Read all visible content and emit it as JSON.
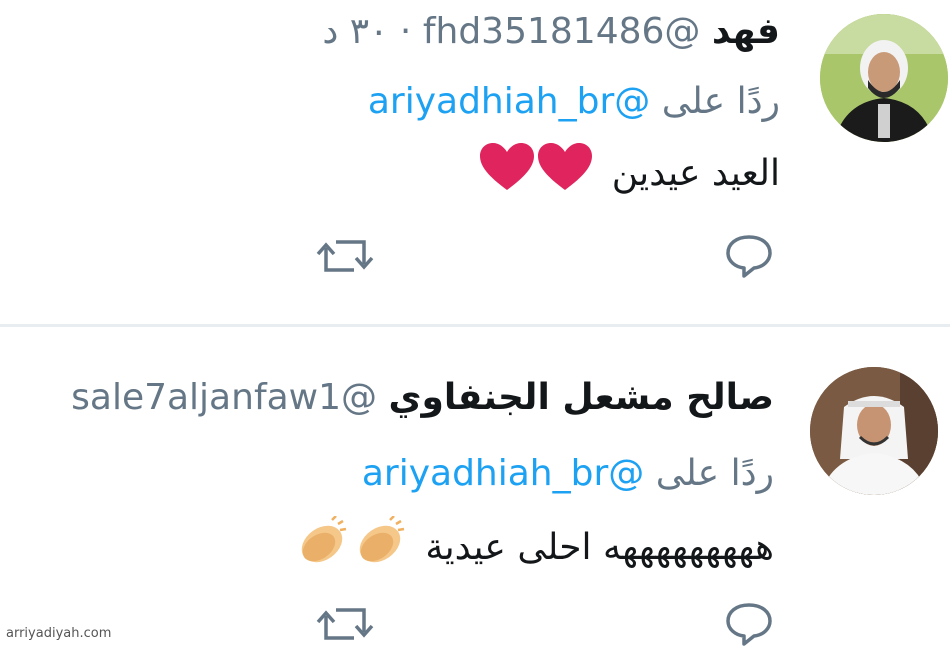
{
  "tweets": [
    {
      "name": "فهد",
      "handle": "@fhd35181486",
      "separator": "·",
      "time": "٣٠ د",
      "reply_prefix": "ردًا على",
      "reply_to": "@ariyadhiah_br",
      "text": "العيد عيدين",
      "emoji_name": "heart-emoji",
      "emoji_count": 2,
      "actions": {
        "reply": "reply-icon",
        "retweet": "retweet-icon"
      }
    },
    {
      "name": "صالح مشعل الجنفاوي",
      "handle": "@sale7aljanfaw1",
      "reply_prefix": "ردًا على",
      "reply_to": "@ariyadhiah_br",
      "text": "هههههههههه احلى عيدية",
      "emoji_name": "clapping-hands-emoji",
      "emoji_count": 2,
      "actions": {
        "reply": "reply-icon",
        "retweet": "retweet-icon"
      }
    }
  ],
  "colors": {
    "link": "#1da1f2",
    "muted": "#657786",
    "text": "#14171a",
    "heart": "#e0245e",
    "divider": "#e8edf1"
  },
  "watermark": "arriyadiyah.com"
}
